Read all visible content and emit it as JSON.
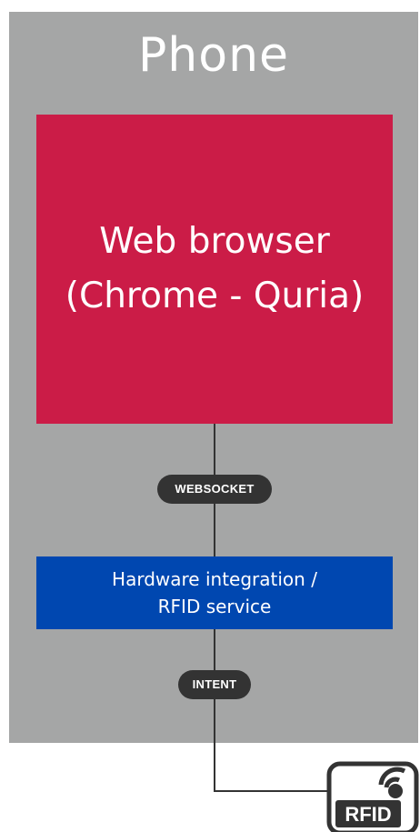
{
  "diagram": {
    "phone": {
      "title": "Phone",
      "background": "#a5a6a6"
    },
    "browser": {
      "line1": "Web browser",
      "line2": "(Chrome - Quria)",
      "color": "#cb1c47"
    },
    "websocket_pill": {
      "label": "WEBSOCKET"
    },
    "service": {
      "line1": "Hardware integration /",
      "line2": "RFID service",
      "color": "#0047b0"
    },
    "intent_pill": {
      "label": "INTENT"
    },
    "rfid_device": {
      "label": "RFID",
      "icon": "rfid-reader-icon"
    },
    "connector_color": "#333333"
  }
}
